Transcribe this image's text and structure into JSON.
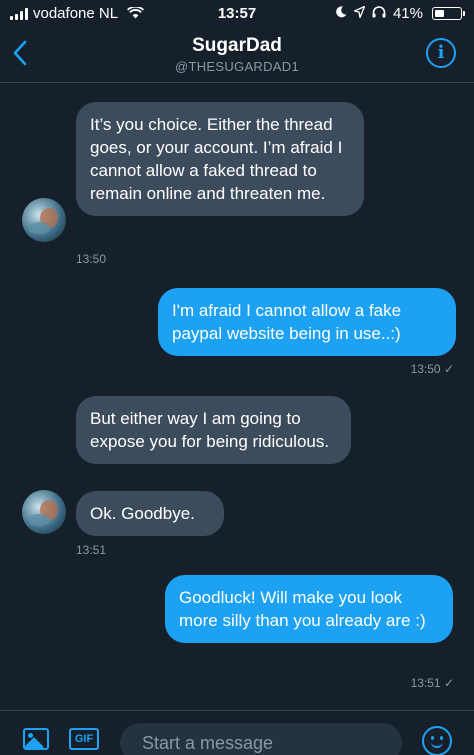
{
  "status_bar": {
    "carrier": "vodafone NL",
    "time": "13:57",
    "battery_text": "41%",
    "battery_level": 0.41,
    "icons": [
      "signal-icon",
      "wifi-icon",
      "moon-icon",
      "location-icon",
      "headphones-icon",
      "battery-icon"
    ]
  },
  "header": {
    "back_icon": "chevron-left-icon",
    "title": "SugarDad",
    "handle": "@THESUGARDAD1",
    "info_icon": "info-icon"
  },
  "messages": [
    {
      "direction": "in",
      "text": "It’s you choice. Either the thread goes, or your account. I’m afraid I cannot allow a faked thread to remain online and threaten me."
    },
    {
      "direction": "in",
      "timestamp": "13:50"
    },
    {
      "direction": "out",
      "text": "I'm afraid I cannot allow a fake paypal website being in use..:)",
      "timestamp": "13:50 ✓"
    },
    {
      "direction": "in",
      "text": "But either way I am going to expose you for being ridiculous."
    },
    {
      "direction": "in",
      "text": "Ok. Goodbye.",
      "timestamp": "13:51"
    },
    {
      "direction": "out",
      "text": "Goodluck! Will make you look more silly than you already are :)",
      "timestamp": "13:51 ✓"
    }
  ],
  "composer": {
    "image_icon": "image-icon",
    "gif_label": "GIF",
    "placeholder": "Start a message",
    "emoji_icon": "emoji-icon"
  },
  "colors": {
    "background": "#15202b",
    "incoming_bubble": "#3d4c5c",
    "outgoing_bubble": "#1da1f2",
    "accent": "#1da1f2",
    "muted_text": "#8899a6"
  }
}
